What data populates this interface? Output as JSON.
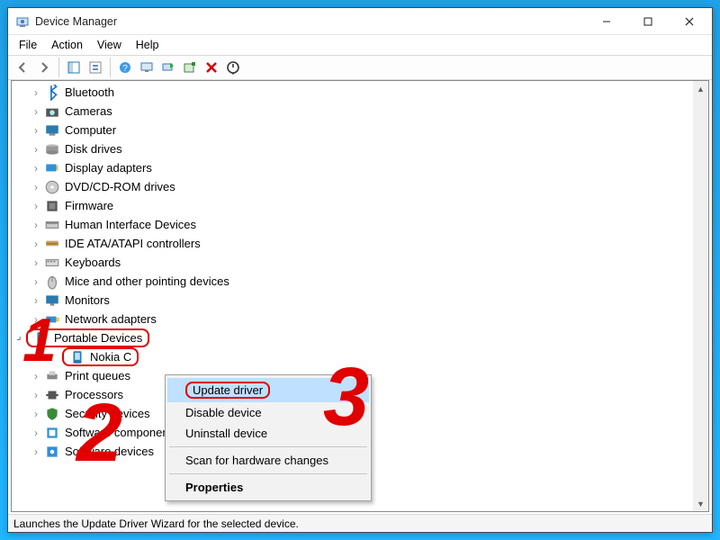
{
  "window": {
    "title": "Device Manager"
  },
  "menu": {
    "file": "File",
    "action": "Action",
    "view": "View",
    "help": "Help"
  },
  "tree": {
    "items": [
      "Bluetooth",
      "Cameras",
      "Computer",
      "Disk drives",
      "Display adapters",
      "DVD/CD-ROM drives",
      "Firmware",
      "Human Interface Devices",
      "IDE ATA/ATAPI controllers",
      "Keyboards",
      "Mice and other pointing devices",
      "Monitors",
      "Network adapters"
    ],
    "portable": {
      "label": "Portable Devices",
      "children": [
        "Nokia C"
      ]
    },
    "after": [
      "Print queues",
      "Processors",
      "Security devices",
      "Software components",
      "Software devices"
    ]
  },
  "ctx": {
    "update": "Update driver",
    "disable": "Disable device",
    "uninstall": "Uninstall device",
    "scan": "Scan for hardware changes",
    "props": "Properties"
  },
  "status": "Launches the Update Driver Wizard for the selected device.",
  "annotations": {
    "n1": "1",
    "n2": "2",
    "n3": "3"
  }
}
